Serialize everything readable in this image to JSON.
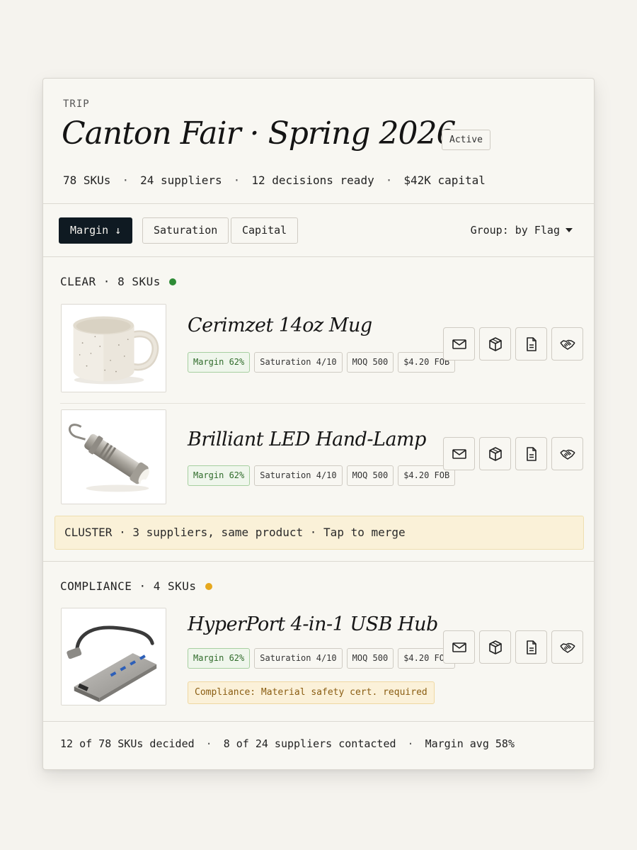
{
  "header": {
    "eyebrow": "TRIP",
    "title": "Canton Fair · Spring 2026",
    "status_badge": "Active",
    "stats": [
      "78 SKUs",
      "24 suppliers",
      "12 decisions ready",
      "$42K capital"
    ],
    "separator": "·"
  },
  "toolbar": {
    "sort_buttons": [
      {
        "label": "Margin ↓",
        "active": true
      },
      {
        "label": "Saturation",
        "active": false
      },
      {
        "label": "Capital",
        "active": false
      }
    ],
    "group_label": "Group: by Flag"
  },
  "sections": [
    {
      "label": "CLEAR · 8 SKUs",
      "dot_color": "#2e8b36",
      "products": [
        {
          "name": "Cerimzet 14oz Mug",
          "image": "mug",
          "chips": [
            "Margin 62%",
            "Saturation 4/10",
            "MOQ 500",
            "$4.20 FOB"
          ]
        },
        {
          "name": "Brilliant LED Hand-Lamp",
          "image": "flashlight",
          "chips": [
            "Margin 62%",
            "Saturation 4/10",
            "MOQ 500",
            "$4.20 FOB"
          ]
        }
      ],
      "cluster_banner": "CLUSTER · 3 suppliers, same product · Tap to merge"
    },
    {
      "label": "COMPLIANCE · 4 SKUs",
      "dot_color": "#e6a81e",
      "products": [
        {
          "name": "HyperPort 4-in-1 USB Hub",
          "image": "usb-hub",
          "chips": [
            "Margin 62%",
            "Saturation 4/10",
            "MOQ 500",
            "$4.20 FOB"
          ],
          "note": "Compliance: Material safety cert. required"
        }
      ]
    }
  ],
  "row_actions": [
    "mail-icon",
    "box-icon",
    "document-icon",
    "handshake-icon"
  ],
  "footer": [
    "12 of 78 SKUs decided",
    "8 of 24 suppliers contacted",
    "Margin avg 58%"
  ],
  "colors": {
    "background": "#f5f3ee",
    "card": "#f8f7f2",
    "primary_button": "#0f1a22",
    "positive": "#2f6b2a",
    "warning_bg": "#faf1d8"
  }
}
